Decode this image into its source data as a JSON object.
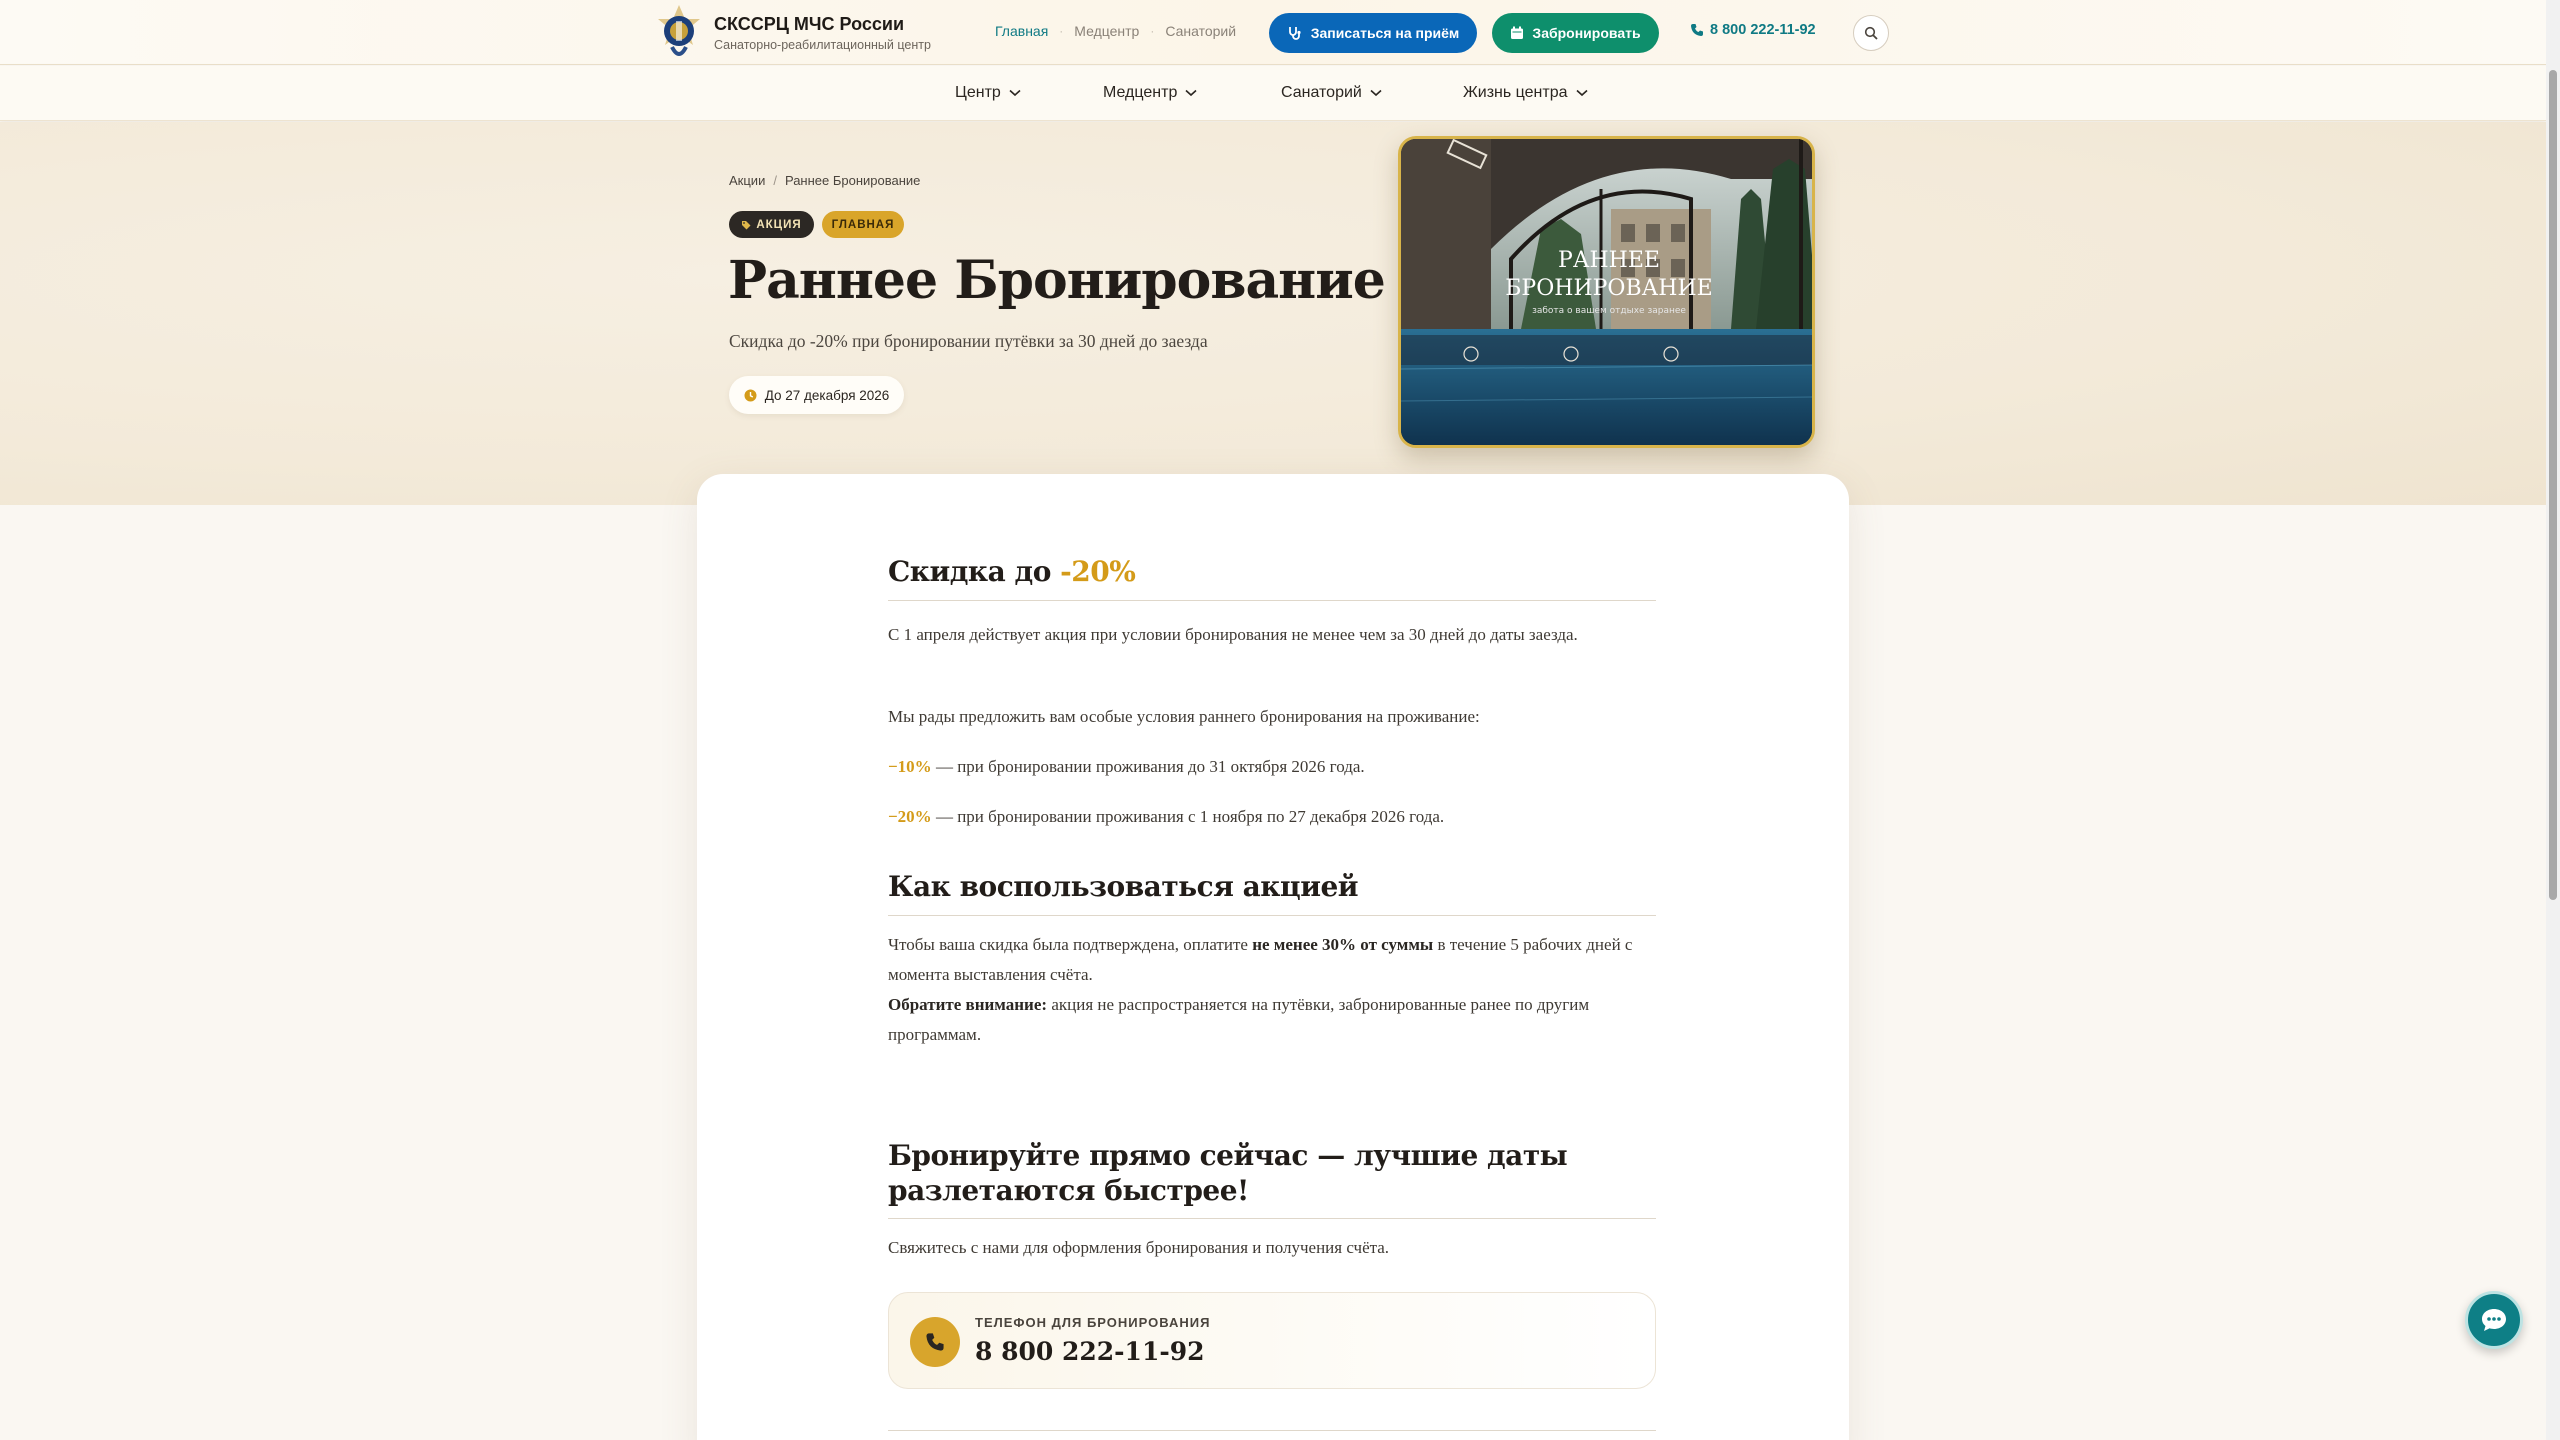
{
  "header": {
    "brand_title": "СКССРЦ МЧС России",
    "brand_subtitle": "Санаторно-реабилитационный центр",
    "nav": [
      {
        "label": "Главная",
        "active": true
      },
      {
        "label": "Медцентр",
        "active": false
      },
      {
        "label": "Санаторий",
        "active": false
      }
    ],
    "appoint_label": "Записаться на приём",
    "book_label": "Забронировать",
    "phone": "8 800 222-11-92"
  },
  "subnav": [
    "Центр",
    "Медцентр",
    "Санаторий",
    "Жизнь центра"
  ],
  "hero": {
    "breadcrumb": [
      "Акции",
      "Раннее Бронирование"
    ],
    "tag_promo": "АКЦИЯ",
    "tag_main": "ГЛАВНАЯ",
    "title": "Раннее Бронирование",
    "subtitle": "Скидка до -20% при бронировании путёвки за 30 дней до заезда",
    "date": "До 27 декабря 2026",
    "image": {
      "title_line1": "РАННЕЕ",
      "title_line2": "БРОНИРОВАНИЕ",
      "caption": "забота о вашем отдыхе заранее"
    }
  },
  "section1": {
    "title_prefix": "Скидка до ",
    "title_accent": "-20%",
    "p1": "С 1 апреля действует акция при условии бронирования не менее чем за 30 дней до даты заезда.",
    "p2": "Мы рады предложить вам особые условия раннего бронирования на проживание:",
    "item1_pct": "−10%",
    "item1_text": " — при бронировании проживания до 31 октября 2026 года.",
    "item2_pct": "−20%",
    "item2_text": " — при бронировании проживания с 1 ноября по 27 декабря 2026 года."
  },
  "section2": {
    "title": "Как воспользоваться акцией",
    "p1_a": "Чтобы ваша скидка была подтверждена, оплатите ",
    "p1_b": "не менее 30% от суммы",
    "p1_c": " в течение 5 рабочих дней с момента выставления счёта.",
    "p2_a": "Обратите внимание:",
    "p2_b": " акция не распространяется на путёвки, забронированные ранее по другим программам."
  },
  "section3": {
    "title_line1": "Бронируйте прямо сейчас — лучшие даты",
    "title_line2": "разлетаются быстрее!",
    "p1": "Свяжитесь с нами для оформления бронирования и получения счёта."
  },
  "phone_card": {
    "label": "ТЕЛЕФОН ДЛЯ БРОНИРОВАНИЯ",
    "number": "8 800 222-11-92"
  },
  "colors": {
    "accent_gold": "#d49b19",
    "appoint_blue": "#0a67b8",
    "book_green": "#0e8f6c",
    "teal_link": "#0f7a84"
  }
}
